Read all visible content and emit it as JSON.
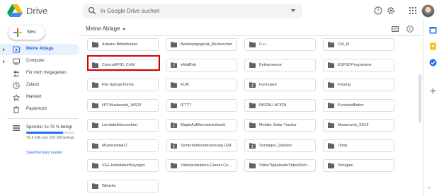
{
  "app": {
    "title": "Drive"
  },
  "search": {
    "placeholder": "In Google Drive suchen"
  },
  "new_button": {
    "label": "Neu"
  },
  "nav": [
    {
      "label": "Meine Ablage",
      "icon": "my-drive-icon",
      "active": true
    },
    {
      "label": "Computer",
      "icon": "computer-icon"
    },
    {
      "label": "Für mich freigegeben",
      "icon": "shared-icon"
    },
    {
      "label": "Zuletzt",
      "icon": "clock-icon"
    },
    {
      "label": "Markiert",
      "icon": "star-icon"
    },
    {
      "label": "Papierkorb",
      "icon": "trash-icon"
    }
  ],
  "storage": {
    "label": "Speicher zu 76 % belegt",
    "usage": "76,4 GB von 100 GB belegt",
    "fraction": 0.76,
    "buy_label": "Speicherplatz kaufen"
  },
  "breadcrumb": "Meine Ablage",
  "folders": [
    {
      "name": "Arduino Bibliotheken",
      "shared": false
    },
    {
      "name": "Beatmungsgerät_Recherchen",
      "shared": false
    },
    {
      "name": "C++",
      "shared": false
    },
    {
      "name": "CM_III",
      "shared": false
    },
    {
      "name": "CoronaRFID_CoW",
      "shared": false
    },
    {
      "name": "eMalRob",
      "shared": true
    },
    {
      "name": "Entrepreneur",
      "shared": false
    },
    {
      "name": "ESP32-Programme",
      "shared": false
    },
    {
      "name": "File Upload Forms",
      "shared": false
    },
    {
      "name": "FLIR",
      "shared": false
    },
    {
      "name": "Formulare",
      "shared": true
    },
    {
      "name": "Fritzing",
      "shared": false
    },
    {
      "name": "HIT-Musterweb_WS20",
      "shared": false
    },
    {
      "name": "IFTTT",
      "shared": false
    },
    {
      "name": "INSTALLATION",
      "shared": false
    },
    {
      "name": "Kunststofflabor",
      "shared": false
    },
    {
      "name": "Lernfabrikkonvertiert",
      "shared": false
    },
    {
      "name": "MapleAufMechatronikwelt",
      "shared": true
    },
    {
      "name": "Mobiler-Solar-Tracker",
      "shared": false
    },
    {
      "name": "Musterweb_SS19",
      "shared": false
    },
    {
      "name": "MusterwebALT",
      "shared": false
    },
    {
      "name": "Sicherheitsunterweisung U24",
      "shared": true
    },
    {
      "name": "Sonstiges_Dateien",
      "shared": true
    },
    {
      "name": "Temp",
      "shared": false
    },
    {
      "name": "VEE-InstallationKeysight",
      "shared": false
    },
    {
      "name": "Videoproduktion-Career-Ce...",
      "shared": false
    },
    {
      "name": "VideoTippsAudioVideoDreh...",
      "shared": false
    },
    {
      "name": "Vorlagen",
      "shared": false
    },
    {
      "name": "Wietzke",
      "shared": false
    }
  ],
  "highlighted_folder": "CoronaRFID_CoW",
  "colors": {
    "accent": "#1a73e8",
    "active_bg": "#e8f0fe",
    "highlight": "#d40000",
    "folder_icon": "#5f6368"
  }
}
